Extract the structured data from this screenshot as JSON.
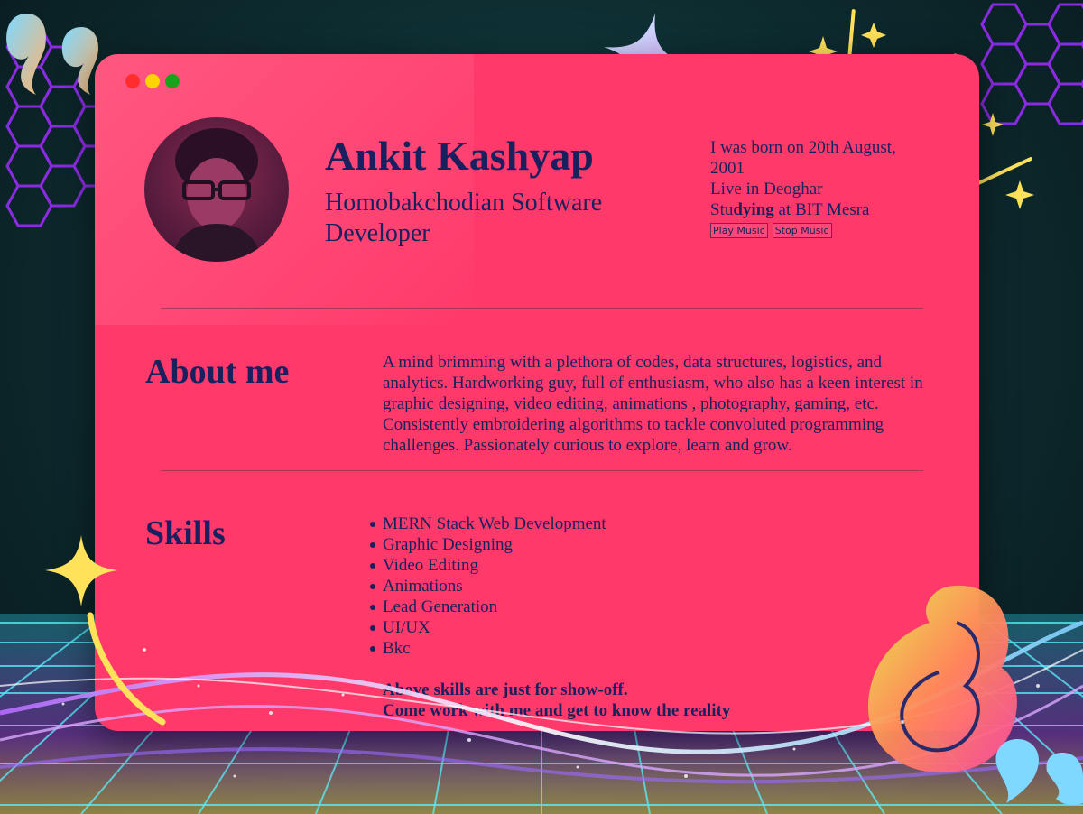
{
  "window": {
    "dots": [
      "#ff2d2d",
      "#ffd500",
      "#1aa31a"
    ]
  },
  "profile": {
    "name": "Ankit Kashyap",
    "role": "Homobakchodian Software Developer",
    "born": "I was born on 20th August, 2001",
    "lives": "Live in Deoghar",
    "studying_a": "Stu",
    "studying_b": "dying",
    "studying_c": " at BIT Mesra",
    "play_label": "Play Music",
    "stop_label": "Stop Music"
  },
  "about": {
    "title": "About me",
    "text": "A mind brimming with a plethora of codes, data structures, logistics, and analytics. Hardworking guy, full of enthusiasm, who also has a keen interest in graphic designing, video editing, animations , photography, gaming, etc. Consistently embroidering algorithms to tackle convoluted programming challenges. Passionately curious to explore, learn and grow."
  },
  "skills": {
    "title": "Skills",
    "items": [
      "MERN Stack Web Development",
      "Graphic Designing",
      "Video Editing",
      "Animations",
      "Lead Generation",
      "UI/UX",
      "Bkc"
    ],
    "note_1": "Above skills are just for show-off.",
    "note_2": "Come work with me and get to know the reality"
  },
  "colors": {
    "card": "#ff3a6b",
    "text": "#1a1f5e",
    "accent_yellow": "#ffe15a"
  }
}
